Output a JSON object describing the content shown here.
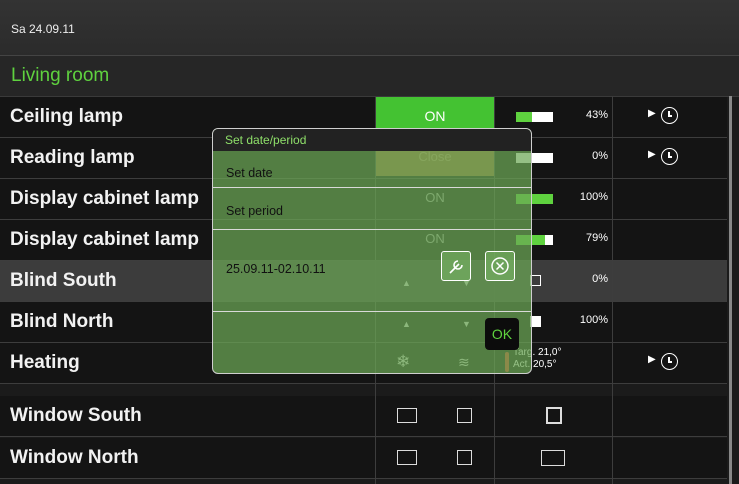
{
  "header": {
    "date": "Sa 24.09.11"
  },
  "room": {
    "title": "Living room"
  },
  "rows": [
    {
      "name": "Ceiling lamp",
      "state": "ON",
      "level_pct": 43,
      "level_label": "43%"
    },
    {
      "name": "Reading lamp",
      "state": "Close",
      "level_pct": 0,
      "level_label": "0%"
    },
    {
      "name": "Display cabinet lamp",
      "state": "ON",
      "level_pct": 100,
      "level_label": "100%"
    },
    {
      "name": "Display cabinet lamp",
      "state": "ON",
      "level_pct": 79,
      "level_label": "79%"
    },
    {
      "name": "Blind South",
      "level_pct": 0,
      "level_label": "0%"
    },
    {
      "name": "Blind North",
      "level_pct": 100,
      "level_label": "100%"
    },
    {
      "name": "Heating",
      "target": "Targ. 21,0°",
      "actual": "Act. 20,5°"
    },
    {
      "name": "Window South"
    },
    {
      "name": "Window North"
    }
  ],
  "dialog": {
    "title": "Set date/period",
    "set_date": "Set date",
    "set_period": "Set period",
    "period_value": "25.09.11-02.10.11",
    "ok": "OK"
  },
  "colors": {
    "accent": "#5fd23f",
    "on_button": "#44c232",
    "dialog_overlay": "#6ca856"
  },
  "icons": [
    "wrench-icon",
    "cancel-circle-icon",
    "clock-icon",
    "play-icon",
    "snowflake-icon",
    "heat-waves-icon",
    "thermometer-icon",
    "window-icon"
  ]
}
